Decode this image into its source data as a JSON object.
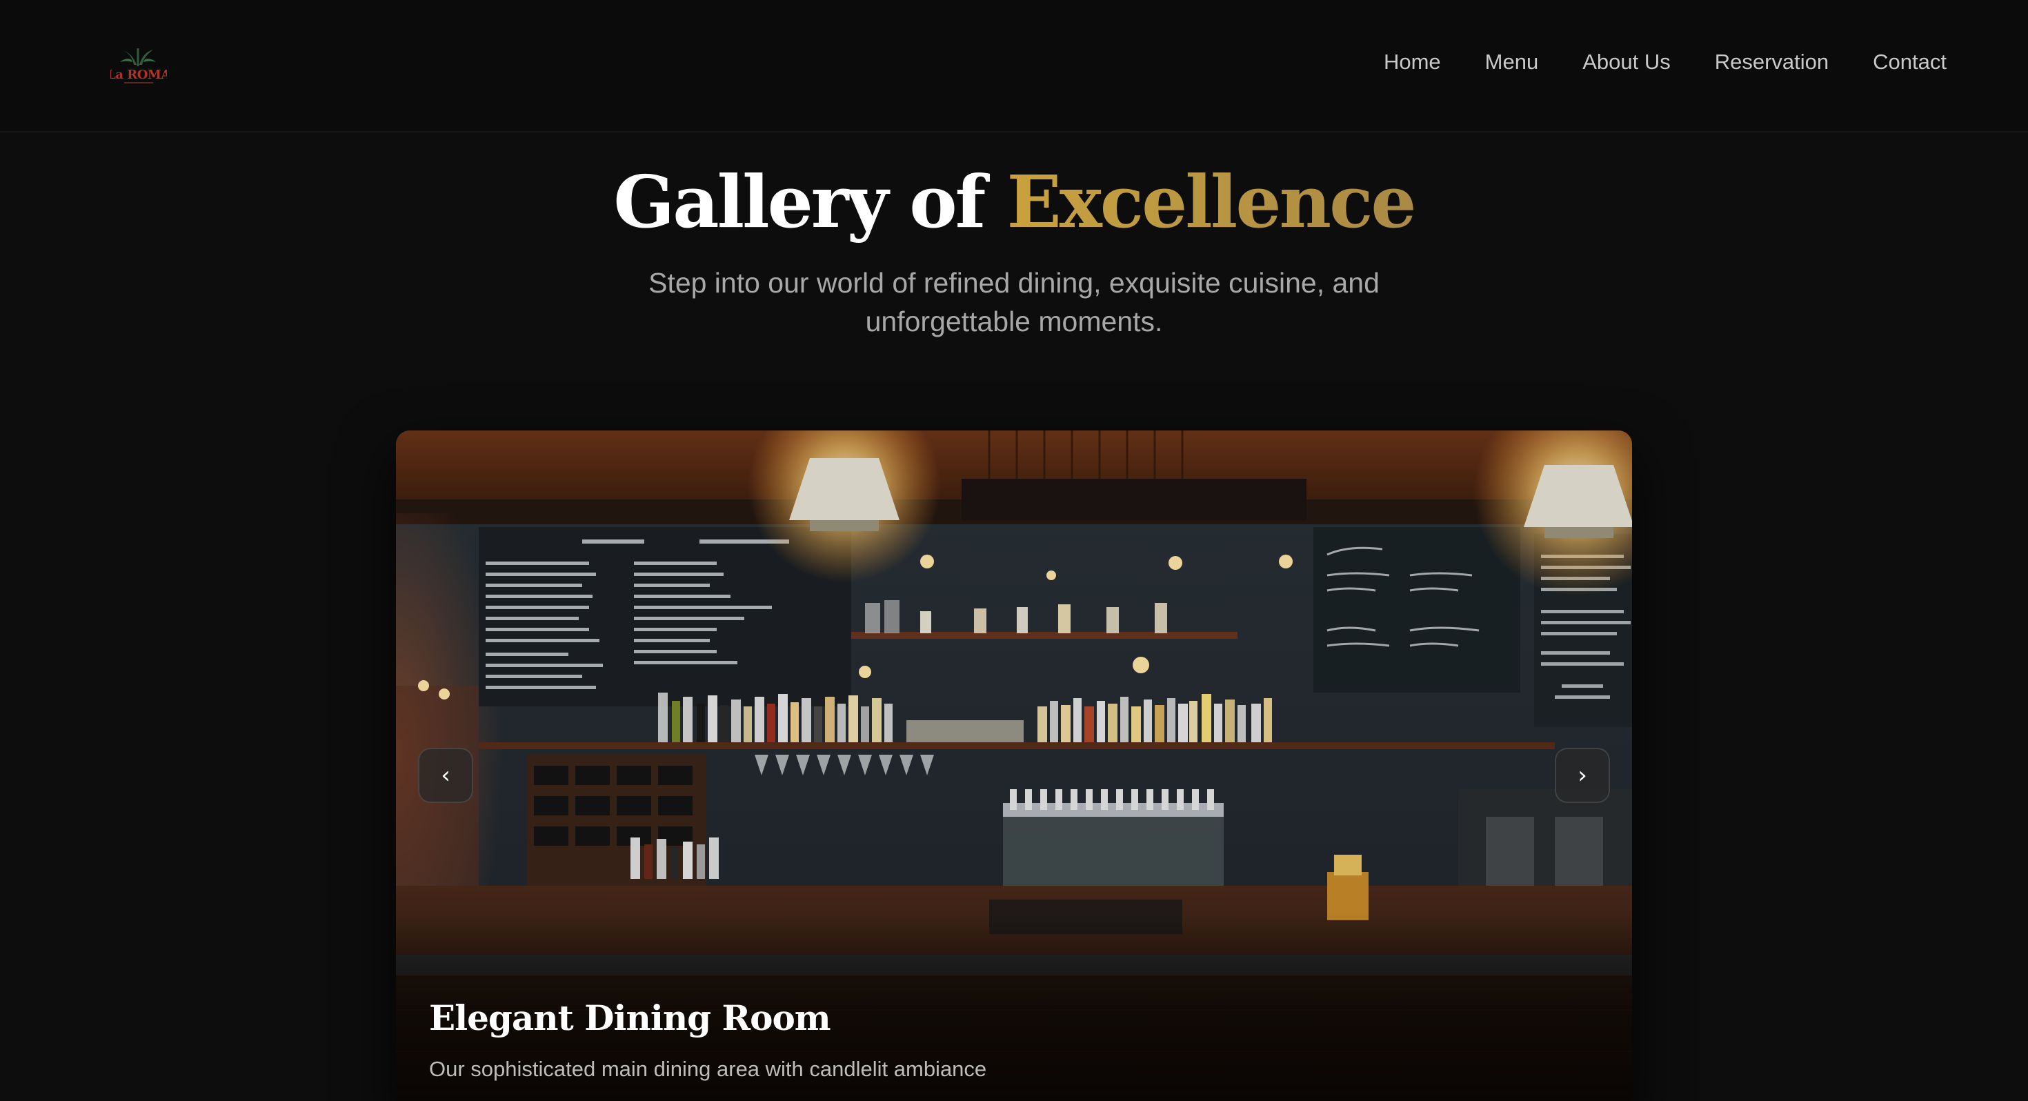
{
  "brand": {
    "logo_text": "La ROMA",
    "accent_color": "#c9a23f"
  },
  "nav": {
    "items": [
      {
        "label": "Home"
      },
      {
        "label": "Menu"
      },
      {
        "label": "About Us"
      },
      {
        "label": "Reservation"
      },
      {
        "label": "Contact"
      }
    ]
  },
  "hero": {
    "title_part1": "Gallery of",
    "title_part2": "Excellence",
    "subtitle": "Step into our world of refined dining, exquisite cuisine, and unforgettable moments."
  },
  "carousel": {
    "prev_icon": "chevron-left-icon",
    "next_icon": "chevron-right-icon",
    "prev_glyph": "‹",
    "next_glyph": "›",
    "slide": {
      "title": "Elegant Dining Room",
      "description": "Our sophisticated main dining area with candlelit ambiance"
    }
  }
}
